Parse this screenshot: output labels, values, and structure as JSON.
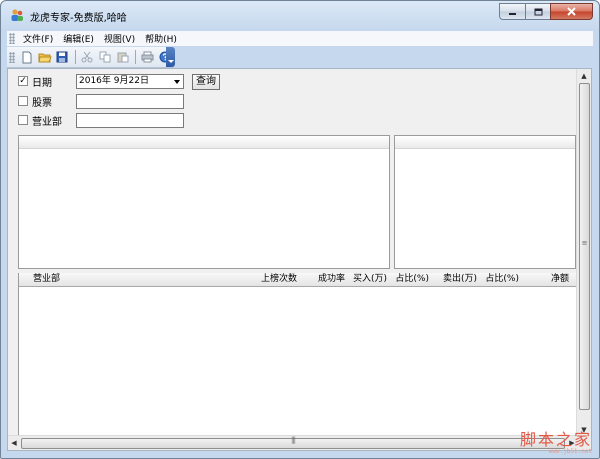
{
  "window": {
    "title": "龙虎专家-免费版,哈哈",
    "icon": "app-people-icon",
    "caption_buttons": {
      "minimize": "minimize-icon",
      "maximize": "maximize-icon",
      "close": "close-icon"
    }
  },
  "menu": {
    "items": [
      {
        "label": "文件(F)"
      },
      {
        "label": "编辑(E)"
      },
      {
        "label": "视图(V)"
      },
      {
        "label": "帮助(H)"
      }
    ]
  },
  "toolbar": {
    "buttons": [
      {
        "icon": "new-file-icon"
      },
      {
        "icon": "open-folder-icon"
      },
      {
        "icon": "save-icon"
      },
      {
        "icon": "cut-icon"
      },
      {
        "icon": "copy-icon"
      },
      {
        "icon": "paste-icon"
      },
      {
        "icon": "print-icon"
      },
      {
        "icon": "help-icon"
      }
    ]
  },
  "filters": {
    "date": {
      "label": "日期",
      "checked": true,
      "value": "2016年  9月22日"
    },
    "stock": {
      "label": "股票",
      "checked": false,
      "value": ""
    },
    "branch": {
      "label": "营业部",
      "checked": false,
      "value": ""
    },
    "query_button": "查询"
  },
  "grid": {
    "columns": [
      "营业部",
      "上榜次数",
      "成功率",
      "买入(万)",
      "占比(%)",
      "卖出(万)",
      "占比(%)",
      "净额"
    ],
    "rows": []
  },
  "watermark": {
    "main": "脚本之家",
    "sub": "www.jb51.net"
  },
  "colors": {
    "close_button": "#c4432c",
    "titlebar": "#c6d8ee",
    "watermark": "#e05a46"
  }
}
